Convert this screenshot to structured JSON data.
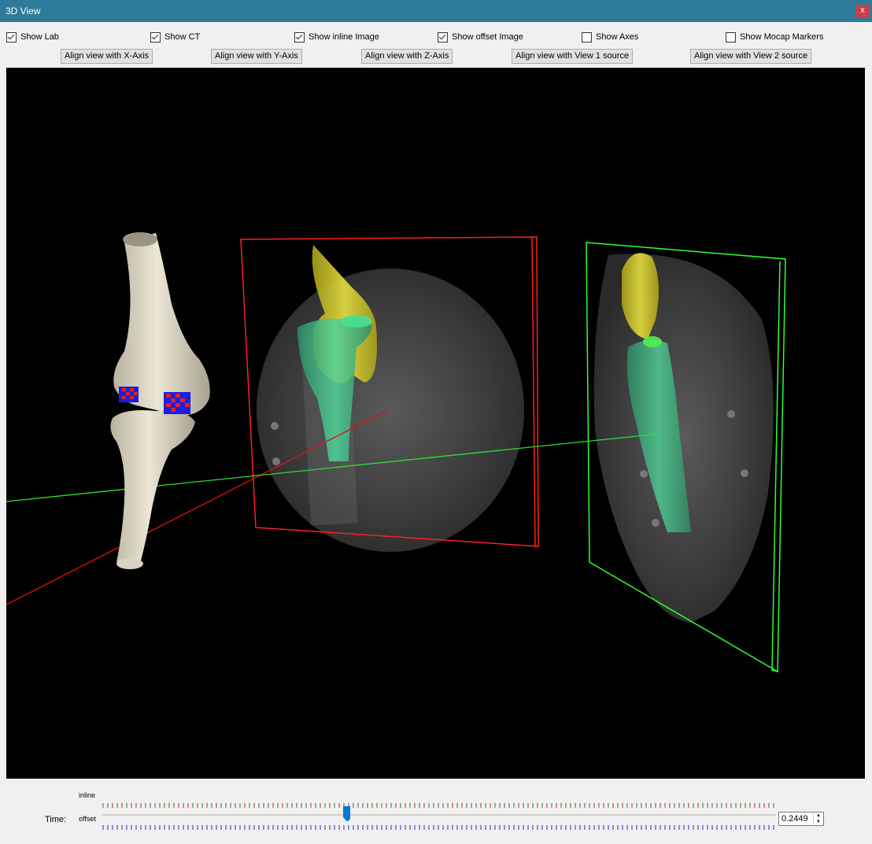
{
  "window": {
    "title": "3D View",
    "close_label": "x"
  },
  "toggles": [
    {
      "label": "Show Lab",
      "checked": true
    },
    {
      "label": "Show CT",
      "checked": true
    },
    {
      "label": "Show inline Image",
      "checked": true
    },
    {
      "label": "Show offset Image",
      "checked": true
    },
    {
      "label": "Show Axes",
      "checked": false
    },
    {
      "label": "Show Mocap Markers",
      "checked": false
    }
  ],
  "buttons": [
    "Align view with X-Axis",
    "Align view with Y-Axis",
    "Align view with Z-Axis",
    "Align view with View 1 source",
    "Align view with View 2 source"
  ],
  "timeline": {
    "time_label": "Time:",
    "inline_label": "inline",
    "offset_label": "offset",
    "value": "0.2449",
    "accent": "#0078d7",
    "inline_colors": [
      "#d02020",
      "#208020"
    ],
    "offset_color": "#2030c0"
  },
  "scene": {
    "background": "#000000",
    "inline_frame_color": "#ff2020",
    "offset_frame_color": "#30ff30",
    "bone_color": "#e6e0cc",
    "femur_overlay_color": "#d8d020",
    "tibia_overlay_color": "#40c080"
  }
}
